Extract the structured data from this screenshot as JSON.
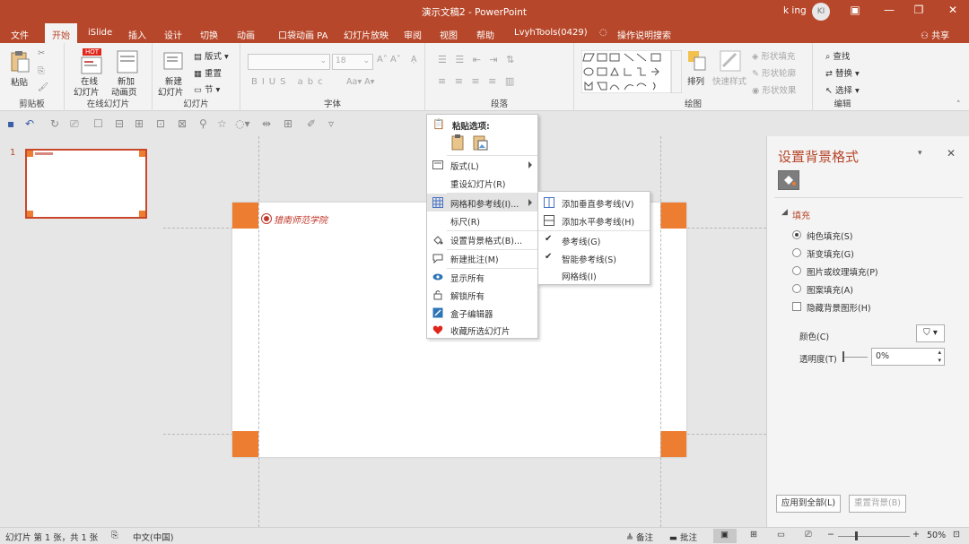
{
  "window": {
    "title": "演示文稿2  -  PowerPoint",
    "user": "k ing",
    "avatar_initials": "KI",
    "share": "共享"
  },
  "tabs": [
    {
      "label": "文件"
    },
    {
      "label": "开始"
    },
    {
      "label": "iSlide"
    },
    {
      "label": "插入"
    },
    {
      "label": "设计"
    },
    {
      "label": "切换"
    },
    {
      "label": "动画"
    },
    {
      "label": "口袋动画 PA"
    },
    {
      "label": "幻灯片放映"
    },
    {
      "label": "审阅"
    },
    {
      "label": "视图"
    },
    {
      "label": "帮助"
    },
    {
      "label": "LvyhTools(0429)"
    },
    {
      "label": "操作说明搜索"
    }
  ],
  "ribbon": {
    "clipboard": {
      "paste": "粘贴",
      "label": "剪贴板"
    },
    "online": {
      "hot": "HOT",
      "btn1": "在线幻灯片",
      "btn1a": "在线",
      "btn1b": "幻灯片",
      "btn2a": "新加",
      "btn2b": "动画页",
      "label": "在线幻灯片"
    },
    "slides": {
      "new1": "新建",
      "new2": "幻灯片",
      "layout": "版式",
      "reset": "重置",
      "section": "节",
      "label": "幻灯片"
    },
    "font": {
      "size": "18",
      "label": "字体"
    },
    "paragraph": {
      "label": "段落"
    },
    "drawing": {
      "arrange": "排列",
      "quickstyle": "快速样式",
      "fill": "形状填充",
      "outline": "形状轮廓",
      "effect": "形状效果",
      "label": "绘图"
    },
    "editing": {
      "find": "查找",
      "replace": "替换",
      "select": "选择",
      "label": "编辑"
    }
  },
  "thumbnails": [
    {
      "number": "1"
    }
  ],
  "slide": {
    "logo_text": "猎南师范学院"
  },
  "context_menu": {
    "paste_header": "粘贴选项:",
    "items": [
      {
        "label": "版式(L)",
        "icon": "layout-icon"
      },
      {
        "label": "重设幻灯片(R)",
        "icon": ""
      },
      {
        "label": "网格和参考线(I)...",
        "icon": "grid-icon"
      },
      {
        "label": "标尺(R)",
        "icon": ""
      },
      {
        "label": "设置背景格式(B)...",
        "icon": "background-icon"
      },
      {
        "label": "新建批注(M)",
        "icon": "comment-icon"
      },
      {
        "label": "显示所有",
        "icon": "eye-icon"
      },
      {
        "label": "解锁所有",
        "icon": "unlock-icon"
      },
      {
        "label": "盒子编辑器",
        "icon": "edit-icon"
      },
      {
        "label": "收藏所选幻灯片",
        "icon": "heart-icon"
      }
    ]
  },
  "submenu": {
    "items": [
      {
        "label": "添加垂直参考线(V)"
      },
      {
        "label": "添加水平参考线(H)"
      },
      {
        "label": "参考线(G)"
      },
      {
        "label": "智能参考线(S)"
      },
      {
        "label": "网格线(I)"
      }
    ]
  },
  "format_panel": {
    "title": "设置背景格式",
    "section": "填充",
    "options": [
      {
        "label": "纯色填充(S)",
        "selected": true
      },
      {
        "label": "渐变填充(G)",
        "selected": false
      },
      {
        "label": "图片或纹理填充(P)",
        "selected": false
      },
      {
        "label": "图案填充(A)",
        "selected": false
      }
    ],
    "hide_bg": "隐藏背景图形(H)",
    "color_label": "颜色(C)",
    "transparency_label": "透明度(T)",
    "transparency_value": "0%",
    "apply_all": "应用到全部(L)",
    "reset_bg": "重置背景(B)"
  },
  "status": {
    "slide_info": "幻灯片 第 1 张，共 1 张",
    "language": "中文(中国)",
    "notes": "备注",
    "comments": "批注",
    "zoom": "50%"
  },
  "colors": {
    "accent": "#b7472a",
    "orange": "#ed7d31"
  }
}
